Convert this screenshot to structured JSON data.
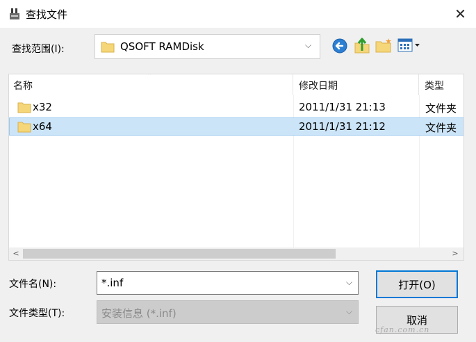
{
  "window": {
    "title": "查找文件",
    "close_glyph": "✕"
  },
  "lookin": {
    "label": "查找范围(I):",
    "value": "QSOFT RAMDisk"
  },
  "toolbar": {
    "icons": [
      "back-icon",
      "up-folder-icon",
      "new-folder-icon",
      "views-menu-icon"
    ]
  },
  "list": {
    "columns": [
      "名称",
      "修改日期",
      "类型"
    ],
    "rows": [
      {
        "name": "x32",
        "date": "2011/1/31 21:13",
        "type": "文件夹"
      },
      {
        "name": "x64",
        "date": "2011/1/31 21:12",
        "type": "文件夹"
      }
    ],
    "selected_row": 1
  },
  "filename": {
    "label": "文件名(N):",
    "value": "*.inf"
  },
  "filetype": {
    "label": "文件类型(T):",
    "value": "安装信息 (*.inf)"
  },
  "buttons": {
    "open": "打开(O)",
    "cancel": "取消"
  },
  "watermark": "cfan.com.cn",
  "colors": {
    "selection": "#cce4f7",
    "selection_border": "#99c9ef",
    "focus": "#0078d7",
    "folder": "#f5d77a"
  }
}
